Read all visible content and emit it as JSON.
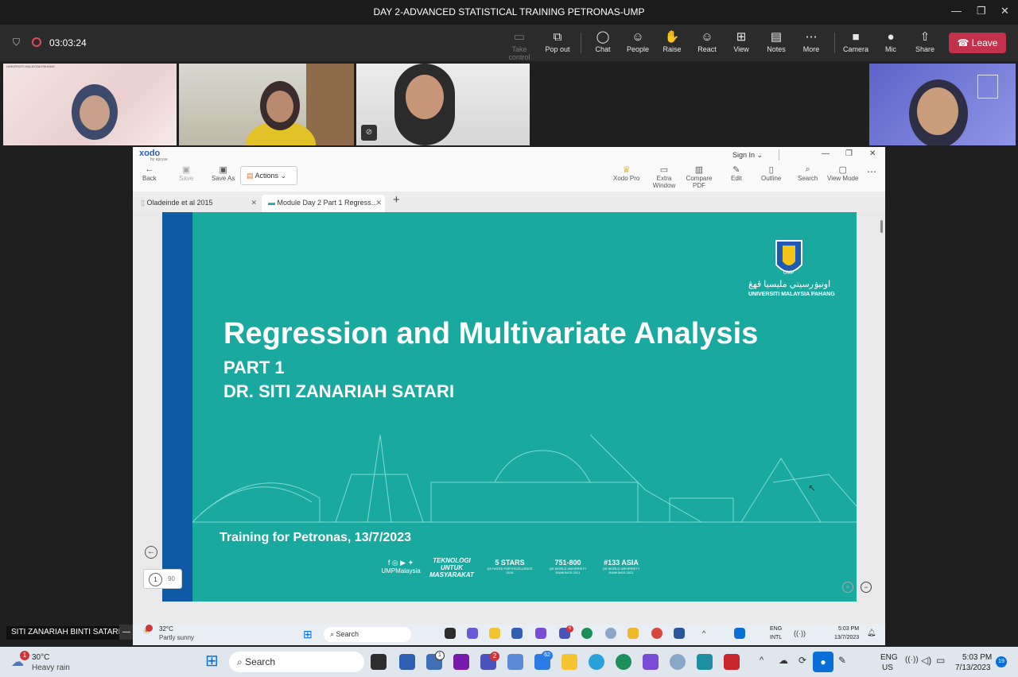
{
  "window": {
    "title": "DAY 2-ADVANCED STATISTICAL TRAINING PETRONAS-UMP"
  },
  "meeting": {
    "timer": "03:03:24",
    "toolbar": [
      {
        "label": "Take control",
        "icon": "take-control-icon",
        "glyph": "▭"
      },
      {
        "label": "Pop out",
        "icon": "pop-out-icon",
        "glyph": "⧉"
      },
      {
        "label": "Chat",
        "icon": "chat-icon",
        "glyph": "◯"
      },
      {
        "label": "People",
        "icon": "people-icon",
        "glyph": "☺"
      },
      {
        "label": "Raise",
        "icon": "raise-hand-icon",
        "glyph": "✋"
      },
      {
        "label": "React",
        "icon": "react-icon",
        "glyph": "☺"
      },
      {
        "label": "View",
        "icon": "view-icon",
        "glyph": "⊞"
      },
      {
        "label": "Notes",
        "icon": "notes-icon",
        "glyph": "▤"
      },
      {
        "label": "More",
        "icon": "more-icon",
        "glyph": "⋯"
      },
      {
        "label": "Camera",
        "icon": "camera-icon",
        "glyph": "■"
      },
      {
        "label": "Mic",
        "icon": "mic-icon",
        "glyph": "●"
      },
      {
        "label": "Share",
        "icon": "share-icon",
        "glyph": "⇧"
      }
    ],
    "leave_label": "Leave",
    "participant_name": "SITI ZANARIAH BINTI SATARI.",
    "tile_caption": "UNIVERSITI MALAYSIA PAHANG"
  },
  "xodo": {
    "brand": "xodo",
    "brand_sub": "by apryse",
    "sign_in": "Sign In",
    "toolbar": {
      "back": "Back",
      "save": "Save",
      "save_as": "Save As",
      "actions": "Actions",
      "xodo_pro": "Xodo Pro",
      "extra_window": "Extra Window",
      "compare_pdf": "Compare PDF",
      "edit": "Edit",
      "outline": "Outline",
      "search": "Search",
      "view_mode": "View Mode"
    },
    "tabs": [
      "Oladeinde et al 2015",
      "Module Day 2 Part 1 Regress..."
    ],
    "page_current": "1",
    "page_total": "90"
  },
  "slide": {
    "title": "Regression and Multivariate Analysis",
    "part": "PART 1",
    "author": "DR. SITI ZANARIAH SATARI",
    "event": "Training for Petronas, 13/7/2023",
    "logo_arabic": "اونيۏرسيتي مليسيا ڤهڠ",
    "logo_text": "UNIVERSITI MALAYSIA PAHANG",
    "logo_short": "UMP",
    "footer": {
      "social_glyphs": "f ◎ ▶ ✦",
      "social": "UMPMalaysia",
      "motto1": "TEKNOLOGI",
      "motto2": "UNTUK",
      "motto3": "MASYARAKAT",
      "stars": "5 STARS",
      "stars_sub1": "QS RATED FOR EXCELLENCE",
      "stars_sub2": "2018",
      "rank": "751-800",
      "rank_sub1": "QS WORLD UNIVERSITY",
      "rank_sub2": "RANKINGS 2021",
      "asia": "#133 ASIA",
      "asia_sub1": "QS WORLD UNIVERSITY",
      "asia_sub2": "RANKINGS 2021"
    }
  },
  "inner_taskbar": {
    "weather_temp": "32°C",
    "weather_desc": "Partly sunny",
    "search": "Search",
    "lang1": "ENG",
    "lang2": "INTL",
    "time": "5:03 PM",
    "date": "13/7/2023",
    "badge_teams": "6"
  },
  "taskbar": {
    "weather_temp": "30°C",
    "weather_desc": "Heavy rain",
    "weather_badge": "1",
    "search": "Search",
    "badge_teams": "2",
    "badge_tasks": "62",
    "badge_onenote": "1",
    "lang1": "ENG",
    "lang2": "US",
    "time": "5:03 PM",
    "date": "7/13/2023",
    "notif": "19"
  }
}
